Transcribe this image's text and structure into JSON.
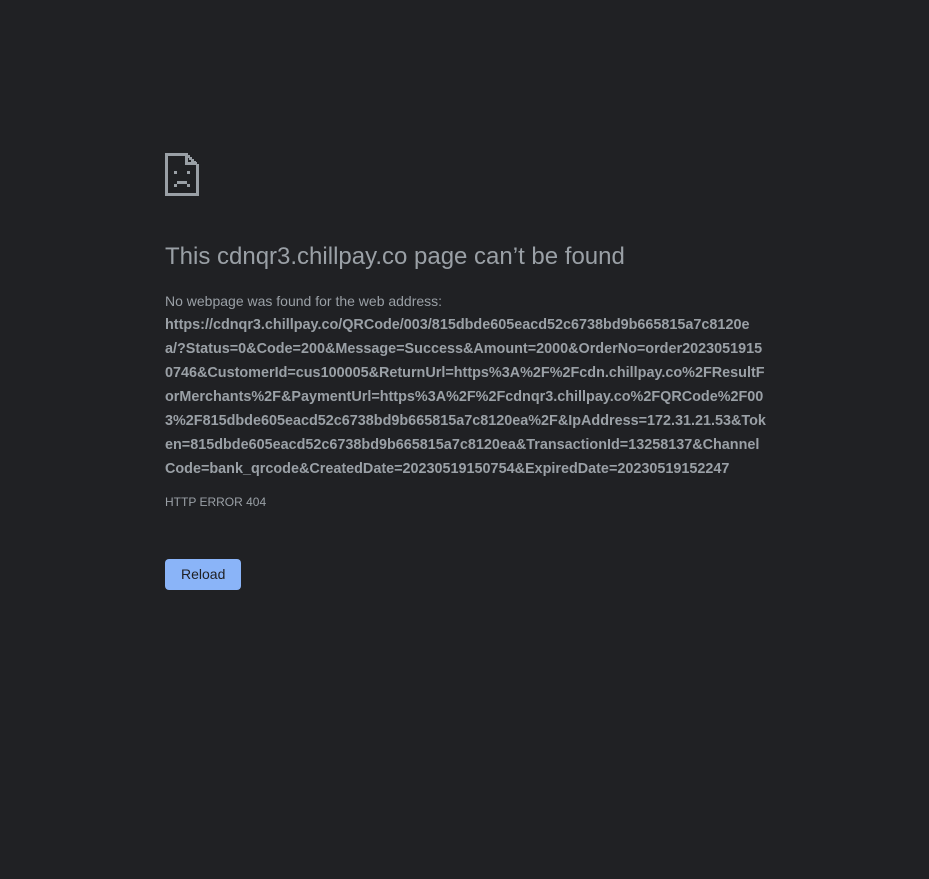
{
  "error_page": {
    "title": "This cdnqr3.chillpay.co page can’t be found",
    "description_prefix": "No webpage was found for the web address:",
    "url": "https://cdnqr3.chillpay.co/QRCode/003/815dbde605eacd52c6738bd9b665815a7c8120ea/?Status=0&Code=200&Message=Success&Amount=2000&OrderNo=order20230519150746&CustomerId=cus100005&ReturnUrl=https%3A%2F%2Fcdn.chillpay.co%2FResultForMerchants%2F&PaymentUrl=https%3A%2F%2Fcdnqr3.chillpay.co%2FQRCode%2F003%2F815dbde605eacd52c6738bd9b665815a7c8120ea%2F&IpAddress=172.31.21.53&Token=815dbde605eacd52c6738bd9b665815a7c8120ea&TransactionId=13258137&ChannelCode=bank_qrcode&CreatedDate=20230519150754&ExpiredDate=20230519152247",
    "error_code": "HTTP ERROR 404",
    "reload_label": "Reload",
    "icon": "sad-page-icon"
  },
  "colors": {
    "background": "#202124",
    "text": "#9aa0a6",
    "button": "#8ab4f8"
  }
}
